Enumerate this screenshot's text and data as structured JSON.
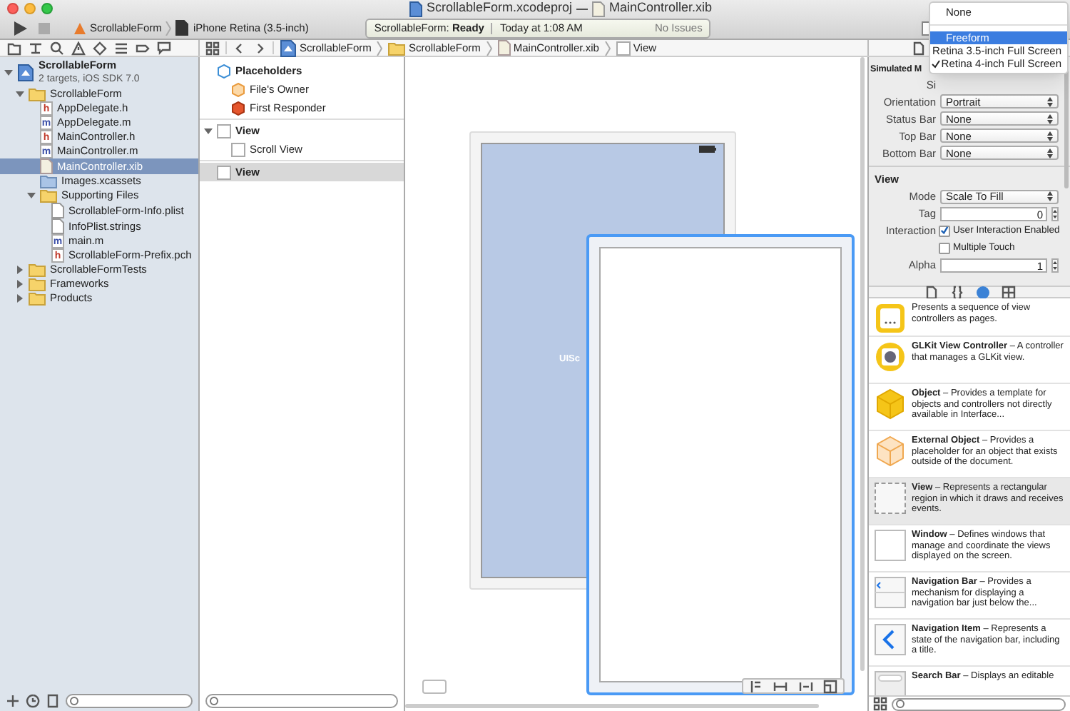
{
  "window": {
    "title": "ScrollableForm.xcodeproj",
    "document": "MainController.xib"
  },
  "toolbar": {
    "scheme": "ScrollableForm",
    "destination": "iPhone Retina (3.5-inch)",
    "activity": {
      "project": "ScrollableForm:",
      "status": "Ready",
      "time": "Today at 1:08 AM",
      "issues": "No Issues"
    }
  },
  "jump_bar": [
    {
      "label": "ScrollableForm",
      "kind": "project"
    },
    {
      "label": "ScrollableForm",
      "kind": "folder"
    },
    {
      "label": "MainController.xib",
      "kind": "xib"
    },
    {
      "label": "View",
      "kind": "view"
    }
  ],
  "navigator": {
    "tree": [
      {
        "label": "ScrollableForm",
        "subtitle": "2 targets, iOS SDK 7.0",
        "kind": "project",
        "expanded": true,
        "selected": false,
        "children": [
          {
            "label": "ScrollableForm",
            "kind": "folder",
            "expanded": true,
            "selected": false,
            "children": [
              {
                "label": "AppDelegate.h",
                "kind": "code",
                "letter": "h",
                "selected": false
              },
              {
                "label": "AppDelegate.m",
                "kind": "code",
                "letter": "m",
                "selected": false
              },
              {
                "label": "MainController.h",
                "kind": "code",
                "letter": "h",
                "selected": false
              },
              {
                "label": "MainController.m",
                "kind": "code",
                "letter": "m",
                "selected": false
              },
              {
                "label": "MainController.xib",
                "kind": "xib",
                "selected": true
              },
              {
                "label": "Images.xcassets",
                "kind": "assets",
                "selected": false
              },
              {
                "label": "Supporting Files",
                "kind": "folder",
                "expanded": true,
                "selected": false,
                "children": [
                  {
                    "label": "ScrollableForm-Info.plist",
                    "kind": "plain",
                    "selected": false
                  },
                  {
                    "label": "InfoPlist.strings",
                    "kind": "plain",
                    "selected": false
                  },
                  {
                    "label": "main.m",
                    "kind": "code",
                    "letter": "m",
                    "selected": false
                  },
                  {
                    "label": "ScrollableForm-Prefix.pch",
                    "kind": "code",
                    "letter": "h",
                    "selected": false
                  }
                ]
              }
            ]
          },
          {
            "label": "ScrollableFormTests",
            "kind": "folder",
            "expanded": false,
            "selected": false
          },
          {
            "label": "Frameworks",
            "kind": "folder",
            "expanded": false,
            "selected": false
          },
          {
            "label": "Products",
            "kind": "folder",
            "expanded": false,
            "selected": false
          }
        ]
      }
    ]
  },
  "outline": [
    {
      "label": "Placeholders",
      "kind": "placeholders",
      "selected": false,
      "children": [
        {
          "label": "File's Owner",
          "kind": "owner",
          "selected": false
        },
        {
          "label": "First Responder",
          "kind": "responder",
          "selected": false
        }
      ]
    },
    {
      "label": "View",
      "kind": "view",
      "expanded": true,
      "selected": false,
      "children": [
        {
          "label": "Scroll View",
          "kind": "view",
          "selected": false
        }
      ]
    },
    {
      "label": "View",
      "kind": "view",
      "selected": true
    }
  ],
  "canvas": {
    "scroll_view_label": "UISc"
  },
  "inspector": {
    "section_title": "Simulated M",
    "size_label": "Si",
    "rows": [
      {
        "kind": "popup",
        "label": "Orientation",
        "value": "Portrait"
      },
      {
        "kind": "popup",
        "label": "Status Bar",
        "value": "None"
      },
      {
        "kind": "popup",
        "label": "Top Bar",
        "value": "None"
      },
      {
        "kind": "popup",
        "label": "Bottom Bar",
        "value": "None"
      },
      {
        "kind": "header",
        "label": "View"
      },
      {
        "kind": "popup",
        "label": "Mode",
        "value": "Scale To Fill"
      },
      {
        "kind": "stepper",
        "label": "Tag",
        "value": "0"
      },
      {
        "kind": "checkbox",
        "label": "Interaction",
        "text": "User Interaction Enabled",
        "checked": true
      },
      {
        "kind": "checkbox",
        "text": "Multiple Touch",
        "checked": false
      },
      {
        "kind": "stepper",
        "label": "Alpha",
        "value": "1"
      }
    ]
  },
  "size_menu": [
    {
      "label": "None",
      "selected": false,
      "checked": false,
      "separator_after": true
    },
    {
      "label": "Freeform",
      "selected": true,
      "checked": false
    },
    {
      "label": "Retina 3.5-inch Full Screen",
      "selected": false,
      "checked": false
    },
    {
      "label": "Retina 4-inch Full Screen",
      "selected": false,
      "checked": true
    }
  ],
  "library": [
    {
      "kind": "page",
      "description": "Presents a sequence of view controllers as pages.",
      "selected": false
    },
    {
      "kind": "glkit",
      "name": "GLKit View Controller",
      "description": "– A controller that manages a GLKit view.",
      "selected": false
    },
    {
      "kind": "object",
      "name": "Object",
      "description": "– Provides a template for objects and controllers not directly available in Interface...",
      "selected": false
    },
    {
      "kind": "external",
      "name": "External Object",
      "description": "– Provides a placeholder for an object that exists outside of the document.",
      "selected": false
    },
    {
      "kind": "view",
      "name": "View",
      "description": "– Represents a rectangular region in which it draws and receives events.",
      "selected": true
    },
    {
      "kind": "window",
      "name": "Window",
      "description": "– Defines windows that manage and coordinate the views displayed on the screen.",
      "selected": false
    },
    {
      "kind": "navbar",
      "name": "Navigation Bar",
      "description": "– Provides a mechanism for displaying a navigation bar just below the...",
      "selected": false
    },
    {
      "kind": "navitem",
      "name": "Navigation Item",
      "description": "– Represents a state of the navigation bar, including a title.",
      "selected": false
    },
    {
      "kind": "searchbar",
      "name": "Search Bar",
      "description": "– Displays an editable",
      "selected": false
    }
  ]
}
